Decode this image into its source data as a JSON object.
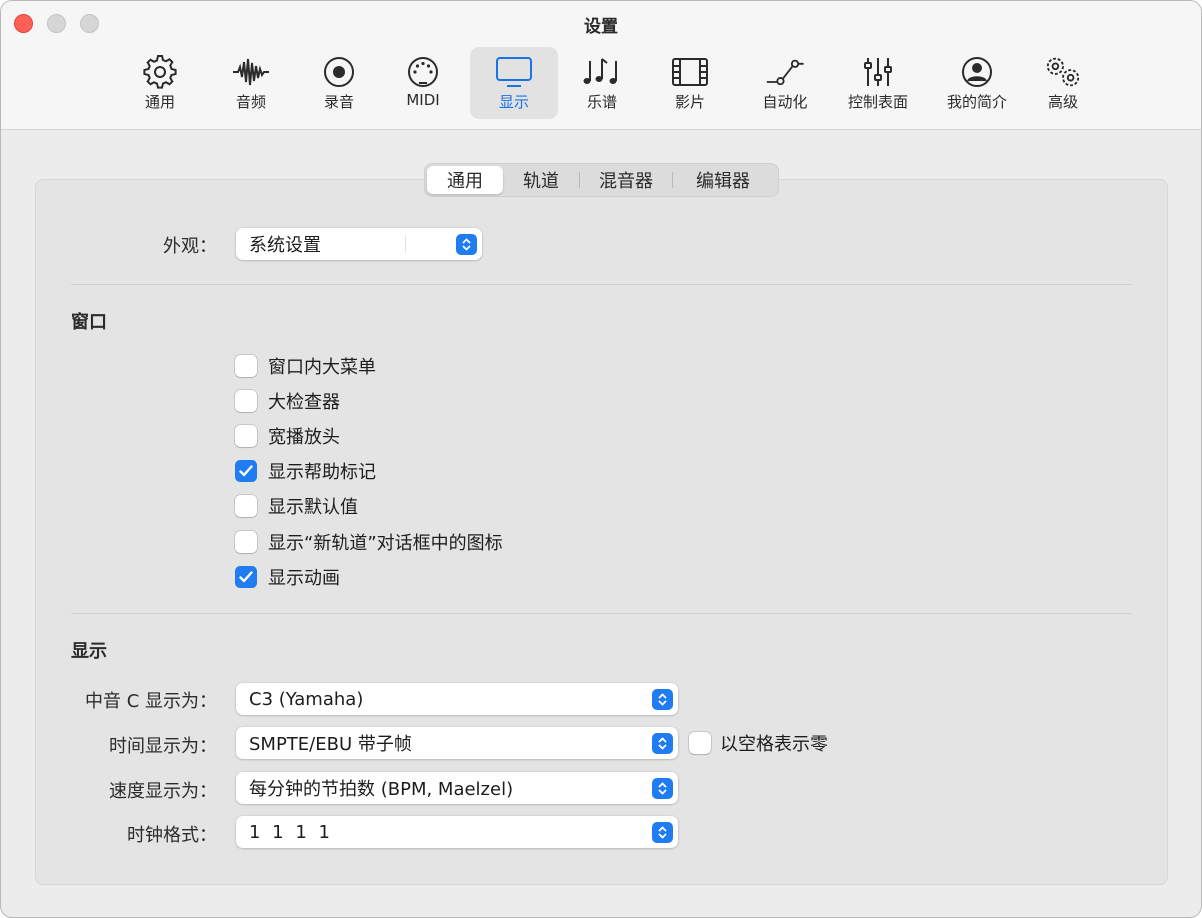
{
  "window": {
    "title": "设置"
  },
  "toolbar": {
    "items": [
      {
        "label": "通用",
        "icon": "gear-icon"
      },
      {
        "label": "音频",
        "icon": "waveform-icon"
      },
      {
        "label": "录音",
        "icon": "record-icon"
      },
      {
        "label": "MIDI",
        "icon": "midi-port-icon"
      },
      {
        "label": "显示",
        "icon": "display-icon",
        "active": true
      },
      {
        "label": "乐谱",
        "icon": "music-notes-icon"
      },
      {
        "label": "影片",
        "icon": "film-icon"
      },
      {
        "label": "自动化",
        "icon": "automation-curve-icon"
      },
      {
        "label": "控制表面",
        "icon": "faders-icon"
      },
      {
        "label": "我的简介",
        "icon": "profile-icon"
      },
      {
        "label": "高级",
        "icon": "gears-icon"
      }
    ]
  },
  "tabs": [
    {
      "label": "通用",
      "active": true
    },
    {
      "label": "轨道"
    },
    {
      "label": "混音器"
    },
    {
      "label": "编辑器"
    }
  ],
  "appearance": {
    "label": "外观：",
    "value": "系统设置"
  },
  "windows_section": {
    "title": "窗口",
    "options": [
      {
        "label": "窗口内大菜单",
        "checked": false
      },
      {
        "label": "大检查器",
        "checked": false
      },
      {
        "label": "宽播放头",
        "checked": false
      },
      {
        "label": "显示帮助标记",
        "checked": true
      },
      {
        "label": "显示默认值",
        "checked": false
      },
      {
        "label": "显示“新轨道”对话框中的图标",
        "checked": false
      },
      {
        "label": "显示动画",
        "checked": true
      }
    ]
  },
  "display_section": {
    "title": "显示",
    "middle_c": {
      "label": "中音 C 显示为：",
      "value": "C3 (Yamaha)"
    },
    "time": {
      "label": "时间显示为：",
      "value": "SMPTE/EBU 带子帧"
    },
    "zero_as_space": {
      "label": "以空格表示零",
      "checked": false
    },
    "tempo": {
      "label": "速度显示为：",
      "value": "每分钟的节拍数 (BPM, Maelzel)"
    },
    "clock": {
      "label": "时钟格式：",
      "value": "1 1 1 1"
    }
  },
  "colors": {
    "accent": "#1f7cf1",
    "close": "#fe5f57"
  }
}
